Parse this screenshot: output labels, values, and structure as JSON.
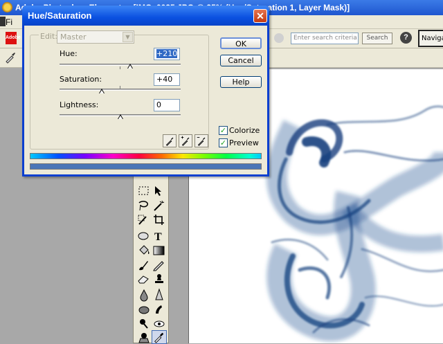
{
  "app": {
    "title": "Adobe Photoshop Elements - [IMG_0035.JPG @ 25% (Hue/Saturation 1, Layer Mask)]",
    "menu_file": "Fi",
    "adobe_logo": "Adobe"
  },
  "toolbar": {
    "search_placeholder": "Enter search criteria",
    "search_button": "Search",
    "help_icon": "?",
    "navigator_tab": "Navigat"
  },
  "dialog": {
    "title": "Hue/Saturation",
    "close_glyph": "✕",
    "edit_label": "Edit:",
    "edit_value": "Master",
    "hue_label": "Hue:",
    "hue_value": "+210",
    "hue_level": 0.58,
    "saturation_label": "Saturation:",
    "saturation_value": "+40",
    "saturation_level": 0.35,
    "lightness_label": "Lightness:",
    "lightness_value": "0",
    "lightness_level": 0.5,
    "ok_button": "OK",
    "cancel_button": "Cancel",
    "help_button": "Help",
    "colorize_label": "Colorize",
    "colorize_checked": "✓",
    "preview_label": "Preview",
    "preview_checked": "✓"
  },
  "colors": {
    "dialog_titlebar": "#0a50e0",
    "smoke": "#1f4d8f",
    "colorized_bar": "#4b76b7"
  },
  "icons": [
    "eyedropper-icon",
    "marquee-icon",
    "move-icon",
    "lasso-icon",
    "magic-wand-icon",
    "crop-icon",
    "ellipse-icon",
    "type-icon",
    "paint-bucket-icon",
    "gradient-icon",
    "brush-icon",
    "pencil-icon",
    "eraser-icon",
    "stamp-icon",
    "blur-icon",
    "sharpen-icon",
    "smudge-icon",
    "dodge-icon",
    "hand-icon",
    "zoom-icon"
  ]
}
